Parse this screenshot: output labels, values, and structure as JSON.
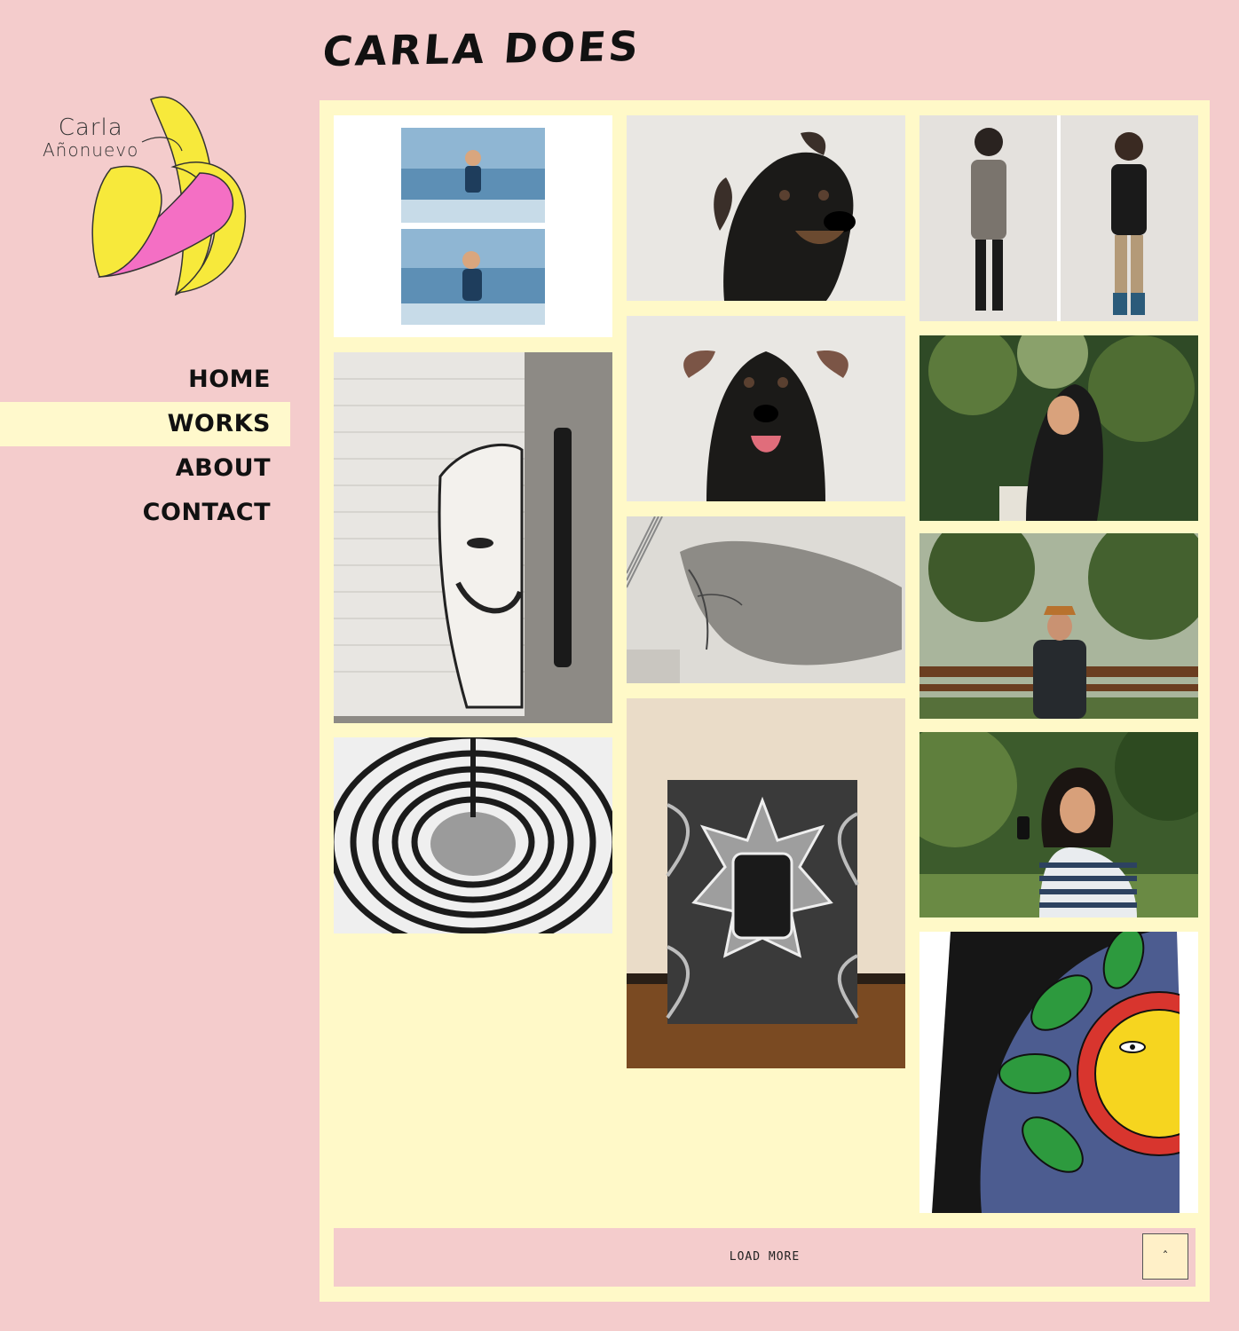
{
  "header": {
    "title": "CARLA DOES"
  },
  "logo": {
    "line1": "Carla",
    "line2": "Añonuevo"
  },
  "nav": {
    "items": [
      {
        "label": "HOME",
        "active": false
      },
      {
        "label": "WORKS",
        "active": true
      },
      {
        "label": "ABOUT",
        "active": false
      },
      {
        "label": "CONTACT",
        "active": false
      }
    ]
  },
  "gallery": {
    "tiles": [
      {
        "column": 1,
        "subject": "boy at the beach, two photos"
      },
      {
        "column": 1,
        "subject": "mask drawing in notebook with pen"
      },
      {
        "column": 1,
        "subject": "black and white apple drawing"
      },
      {
        "column": 2,
        "subject": "black puppy portrait"
      },
      {
        "column": 2,
        "subject": "black puppy smiling"
      },
      {
        "column": 2,
        "subject": "pencil sketch of woman with long hair"
      },
      {
        "column": 2,
        "subject": "painted canvas leaning against wall"
      },
      {
        "column": 3,
        "subject": "two children against white backdrop"
      },
      {
        "column": 3,
        "subject": "woman portrait outdoors"
      },
      {
        "column": 3,
        "subject": "man posing outdoors"
      },
      {
        "column": 3,
        "subject": "woman with phone outdoors"
      },
      {
        "column": 3,
        "subject": "sun painting on canvas"
      }
    ],
    "load_more_label": "LOAD MORE",
    "scroll_top_icon": "chevron-up-icon"
  },
  "colors": {
    "background": "#f4cccc",
    "panel": "#fff9c8",
    "nav_active": "#fff9cc",
    "banana_yellow": "#f7e93b",
    "banana_pink": "#f46fc4"
  }
}
